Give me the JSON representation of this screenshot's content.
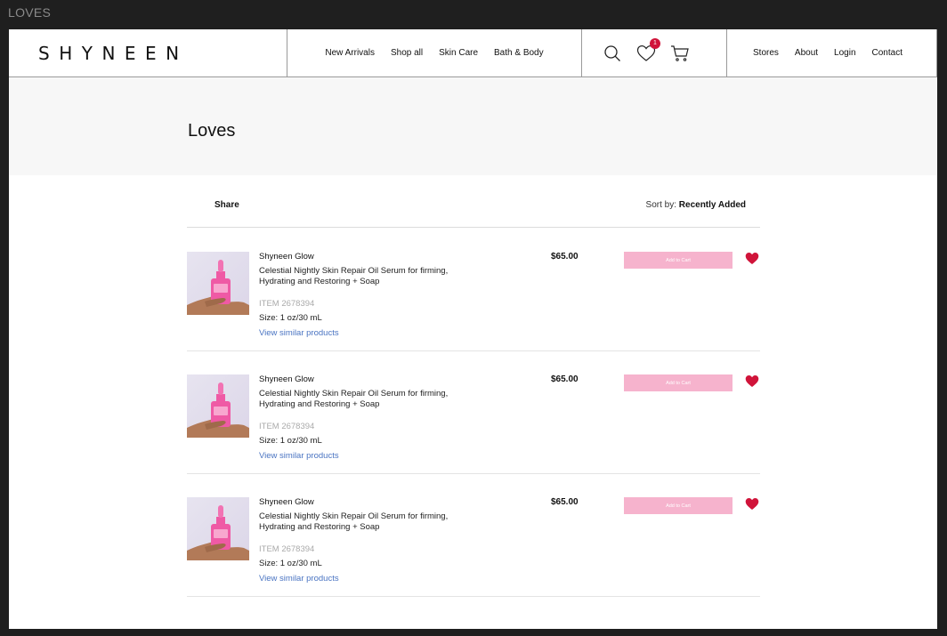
{
  "frame": {
    "title": "LOVES"
  },
  "header": {
    "logo": "SHYNEEN",
    "nav": [
      "New Arrivals",
      "Shop all",
      "Skin Care",
      "Bath & Body"
    ],
    "loves_count": "1",
    "right_links": [
      "Stores",
      "About",
      "Login",
      "Contact"
    ],
    "icons": [
      "search-icon",
      "heart-icon",
      "cart-icon"
    ]
  },
  "hero": {
    "title": "Loves"
  },
  "toolbar": {
    "share": "Share",
    "sort_label": "Sort by:",
    "sort_value": "Recently Added"
  },
  "items": [
    {
      "brand": "Shyneen Glow",
      "description": "Celestial Nightly Skin Repair Oil Serum for firming, Hydrating and Restoring + Soap",
      "item_no": "ITEM 2678394",
      "size": "Size: 1 oz/30 mL",
      "similar": "View similar products",
      "price": "$65.00",
      "cta": "Add to Cart"
    },
    {
      "brand": "Shyneen Glow",
      "description": "Celestial Nightly Skin Repair Oil Serum for firming, Hydrating and Restoring + Soap",
      "item_no": "ITEM 2678394",
      "size": "Size: 1 oz/30 mL",
      "similar": "View similar products",
      "price": "$65.00",
      "cta": "Add to Cart"
    },
    {
      "brand": "Shyneen Glow",
      "description": "Celestial Nightly Skin Repair Oil Serum for firming, Hydrating and Restoring + Soap",
      "item_no": "ITEM 2678394",
      "size": "Size: 1 oz/30 mL",
      "similar": "View similar products",
      "price": "$65.00",
      "cta": "Add to Cart"
    }
  ],
  "colors": {
    "accent_pink": "#f6b3cd",
    "heart_red": "#d0143a",
    "link_blue": "#4a74c2",
    "badge_red": "#d0143a"
  }
}
